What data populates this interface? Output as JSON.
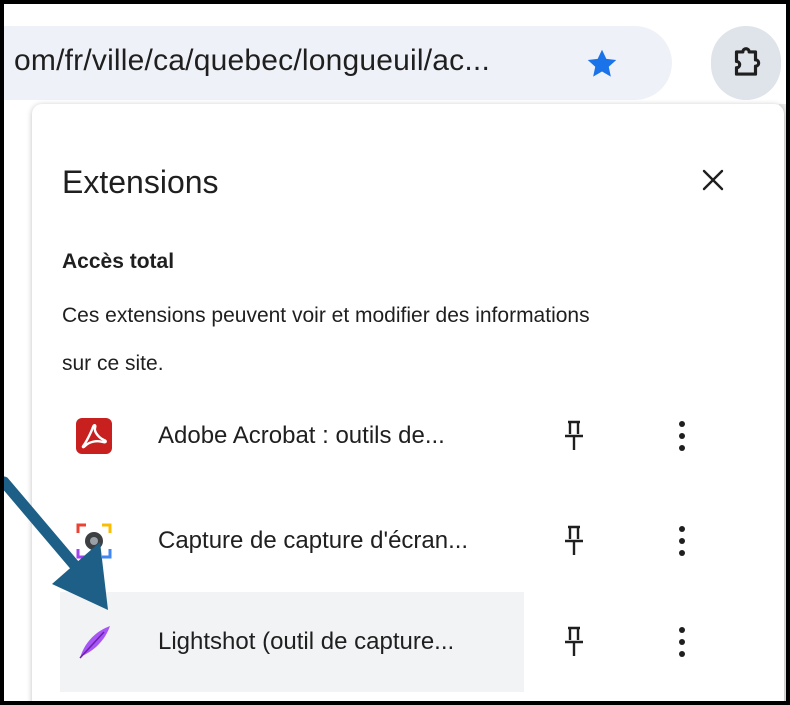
{
  "toolbar": {
    "url": "om/fr/ville/ca/quebec/longueuil/ac...",
    "star_icon": "star-icon",
    "extensions_icon": "puzzle-icon",
    "accent": "#1a73e8"
  },
  "popup": {
    "title": "Extensions",
    "close_icon": "close-icon",
    "section": {
      "heading": "Accès total",
      "description": "Ces extensions peuvent voir et modifier des informations sur ce site."
    },
    "extensions": [
      {
        "name": "Adobe Acrobat : outils de...",
        "icon": "acrobat-icon",
        "pin_icon": "pin-icon",
        "menu_icon": "more-vert-icon"
      },
      {
        "name": "Capture de capture d'écran...",
        "icon": "screen-capture-icon",
        "pin_icon": "pin-icon",
        "menu_icon": "more-vert-icon"
      },
      {
        "name": "Lightshot (outil de capture...",
        "icon": "feather-icon",
        "pin_icon": "pin-icon",
        "menu_icon": "more-vert-icon"
      }
    ]
  },
  "annotation": {
    "arrow_color": "#1d5f86"
  }
}
